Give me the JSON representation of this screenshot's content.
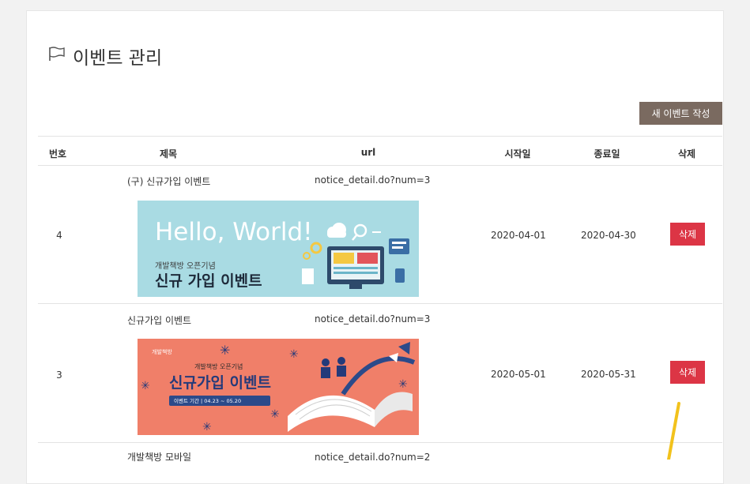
{
  "page": {
    "title": "이벤트 관리"
  },
  "toolbar": {
    "new_event_label": "새 이벤트 작성"
  },
  "table": {
    "headers": {
      "num": "번호",
      "title": "제목",
      "url": "url",
      "start": "시작일",
      "end": "종료일",
      "delete": "삭제"
    },
    "rows": [
      {
        "num": "4",
        "title": "(구) 신규가입 이벤트",
        "url": "notice_detail.do?num=3",
        "start": "2020-04-01",
        "end": "2020-04-30",
        "delete_label": "삭제",
        "banner": {
          "headline": "Hello, World!",
          "sub": "개발책방 오픈기념",
          "main": "신규 가입 이벤트",
          "bg": "#a9dbe3"
        }
      },
      {
        "num": "3",
        "title": "신규가입 이벤트",
        "url": "notice_detail.do?num=3",
        "start": "2020-05-01",
        "end": "2020-05-31",
        "delete_label": "삭제",
        "banner": {
          "logo": "개발책방",
          "sub": "개발책방 오픈기념",
          "main": "신규가입 이벤트",
          "period": "이벤트 기간  |  04.23 ~ 05.20",
          "bg": "#f07f69"
        }
      },
      {
        "num": "",
        "title": "개발책방 모바일",
        "url": "notice_detail.do?num=2"
      }
    ]
  },
  "colors": {
    "accent": "#7a6a60",
    "danger": "#dc3545",
    "annotation": "#f2c21c"
  }
}
